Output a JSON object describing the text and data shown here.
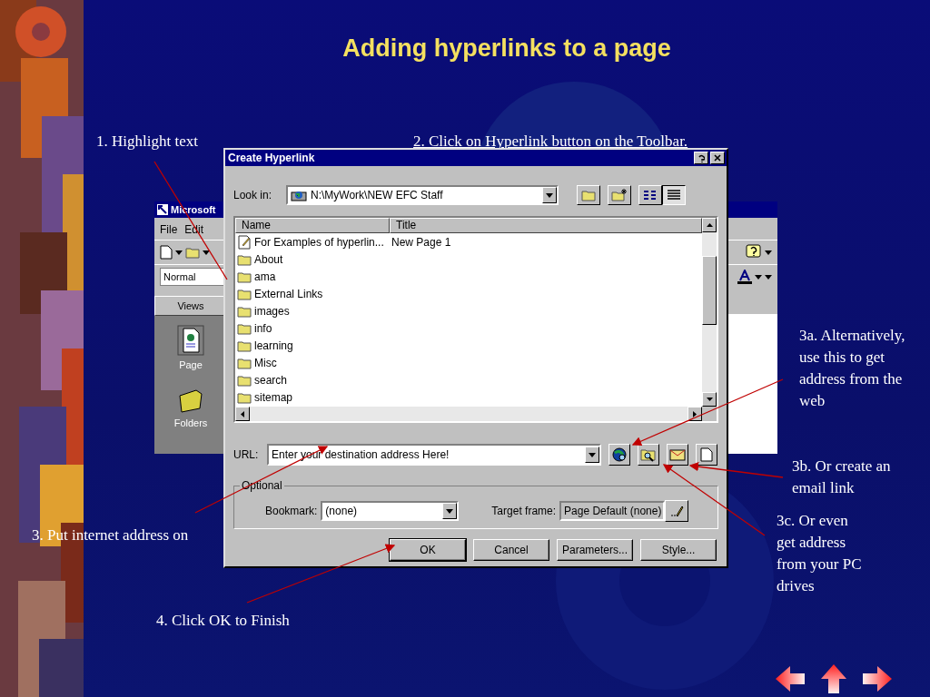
{
  "slide": {
    "title": "Adding hyperlinks to a page"
  },
  "callouts": [
    {
      "text": "1. Highlight text",
      "underlined": false
    },
    {
      "text": "2. Click on Hyperlink button on the Toolbar.",
      "underlined": true
    },
    {
      "text": "3a. Alternatively, use this to get address from the web",
      "underlined": false
    },
    {
      "text": "3b. Or create an email link",
      "underlined": false
    },
    {
      "text": "3c. Or even get address from your PC drives",
      "underlined": false
    },
    {
      "text": "3. Put internet address on",
      "underlined": false
    },
    {
      "text": "4. Click OK to Finish",
      "underlined": false
    }
  ],
  "back_window": {
    "title": "Microsoft",
    "menu": [
      "File",
      "Edit"
    ],
    "style_box": "Normal",
    "views_header": "Views",
    "views": [
      {
        "label": "Page",
        "kind": "page"
      },
      {
        "label": "Folders",
        "kind": "folders"
      }
    ]
  },
  "dialog": {
    "title": "Create Hyperlink",
    "look_in_label": "Look in:",
    "look_in_value": "N:\\MyWork\\NEW EFC Staff",
    "columns": [
      "Name",
      "Title"
    ],
    "files": [
      {
        "name": "For Examples of hyperlin...",
        "title": "New Page 1",
        "kind": "page"
      },
      {
        "name": "About",
        "kind": "folder"
      },
      {
        "name": "ama",
        "kind": "folder"
      },
      {
        "name": "External Links",
        "kind": "folder"
      },
      {
        "name": "images",
        "kind": "folder"
      },
      {
        "name": "info",
        "kind": "folder"
      },
      {
        "name": "learning",
        "kind": "folder"
      },
      {
        "name": "Misc",
        "kind": "folder"
      },
      {
        "name": "search",
        "kind": "folder"
      },
      {
        "name": "sitemap",
        "kind": "folder"
      }
    ],
    "url_label": "URL:",
    "url_value": "Enter your destination address Here!",
    "optional_label": "Optional",
    "bookmark_label": "Bookmark:",
    "bookmark_value": "(none)",
    "target_label": "Target frame:",
    "target_value": "Page Default (none)",
    "buttons": [
      {
        "label": "OK",
        "default": true
      },
      {
        "label": "Cancel",
        "default": false
      },
      {
        "label": "Parameters...",
        "default": false
      },
      {
        "label": "Style...",
        "default": false
      }
    ]
  }
}
